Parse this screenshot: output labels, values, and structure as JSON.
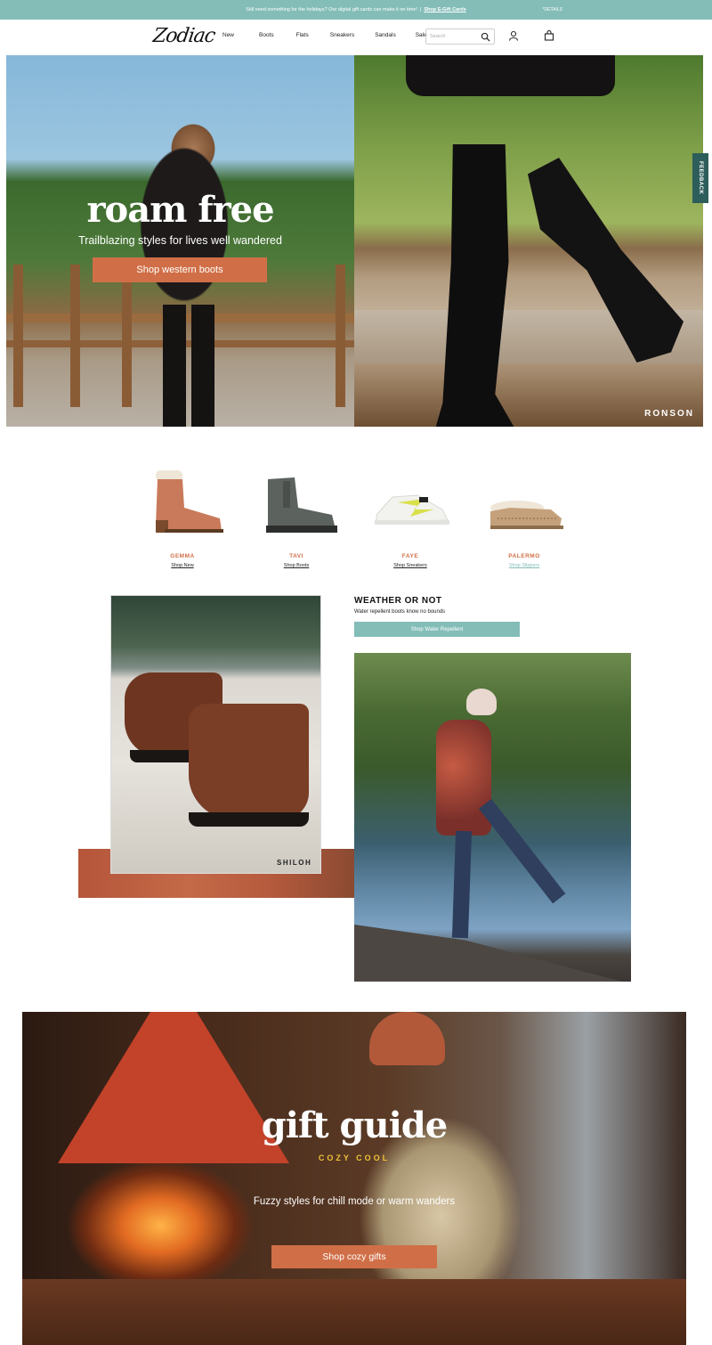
{
  "announcement": {
    "message": "Still need something for the holidays? Our digital gift cards can make it on time!",
    "separator": "|",
    "link": "Shop E-Gift Cards",
    "details": "*DETAILS"
  },
  "header": {
    "logo": "Zodiac",
    "nav": [
      "New",
      "Boots",
      "Flats",
      "Sneakers",
      "Sandals",
      "Sale"
    ],
    "search_placeholder": "Search",
    "icons": [
      "search-icon",
      "account-icon",
      "bag-icon"
    ]
  },
  "hero": {
    "title": "roam free",
    "subtitle": "Trailblazing styles for lives well wandered",
    "button": "Shop western boots",
    "right_caption": "RONSON"
  },
  "feedback_tab": "FEEDBACK",
  "products": [
    {
      "name": "GEMMA",
      "link": "Shop New",
      "color": "#c97a5a"
    },
    {
      "name": "TAVI",
      "link": "Shop Boots",
      "color": "#5c625d"
    },
    {
      "name": "FAYE",
      "link": "Shop Sneakers",
      "color": "#f2f2ee"
    },
    {
      "name": "PALERMO",
      "link": "Shop Slippers",
      "color": "#c4a17a"
    }
  ],
  "weather": {
    "caption": "SHILOH",
    "title": "WEATHER OR NOT",
    "subtitle": "Water repellent boots know no bounds",
    "button": "Shop Water Repellent"
  },
  "gift": {
    "title": "gift guide",
    "kicker": "COZY COOL",
    "subtitle": "Fuzzy styles for chill mode or warm wanders",
    "button": "Shop cozy gifts"
  },
  "colors": {
    "accent_orange": "#d06f47",
    "accent_teal": "#84bdb8",
    "feedback_tab": "#2e5e5b",
    "kicker_gold": "#f0c23a"
  }
}
